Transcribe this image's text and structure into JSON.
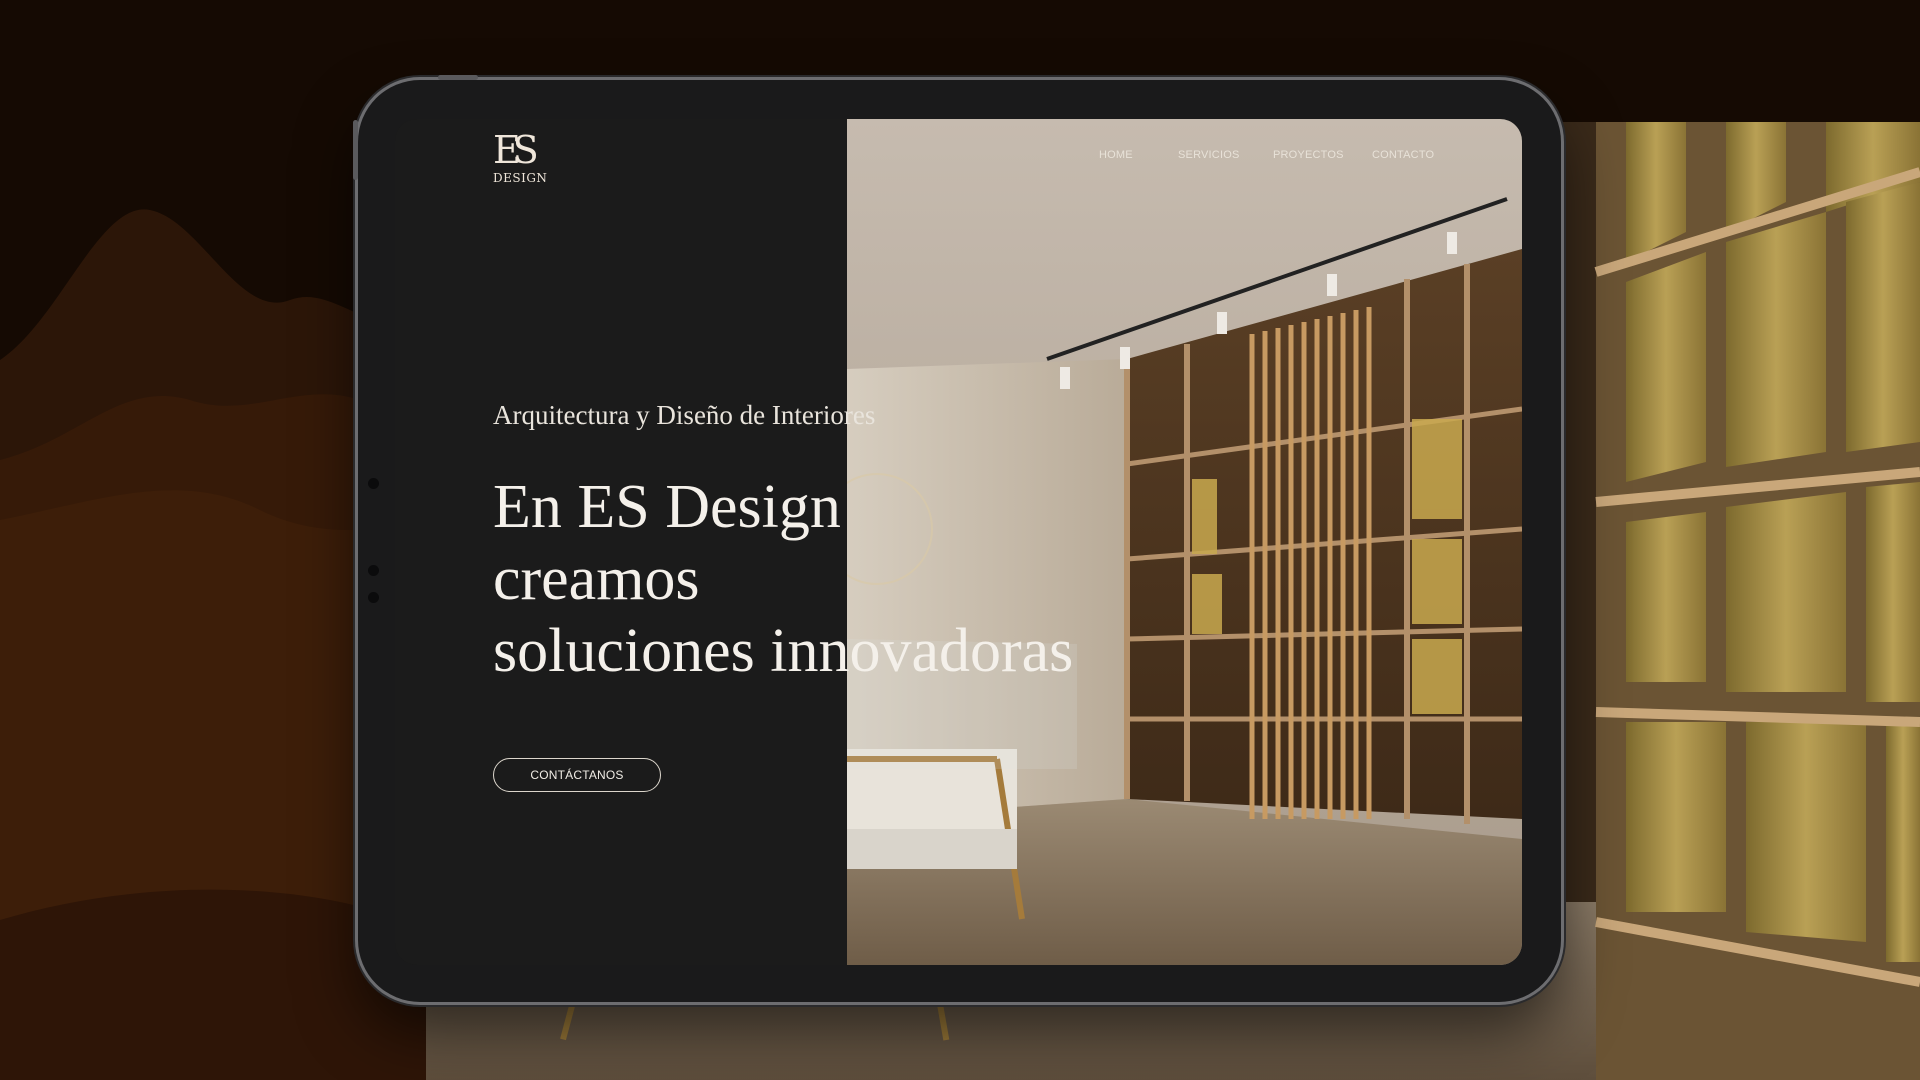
{
  "site": {
    "logo": {
      "monogram": "ES",
      "wordmark": "DESIGN"
    },
    "nav": [
      {
        "label": "HOME"
      },
      {
        "label": "SERVICIOS"
      },
      {
        "label": "PROYECTOS"
      },
      {
        "label": "CONTACTO"
      }
    ],
    "hero": {
      "subtitle": "Arquitectura y Diseño de Interiores",
      "title_lines": [
        "En ES Design",
        "creamos",
        "soluciones innovadoras"
      ],
      "cta_label": "CONTÁCTANOS"
    }
  },
  "colors": {
    "page_background": "#150a03",
    "panel_dark": "#1b1b1b",
    "wood": "#9a7a52",
    "gold": "#b59a4f",
    "text_light": "#f4f0ea"
  },
  "icons": [
    "es-design-logo"
  ]
}
